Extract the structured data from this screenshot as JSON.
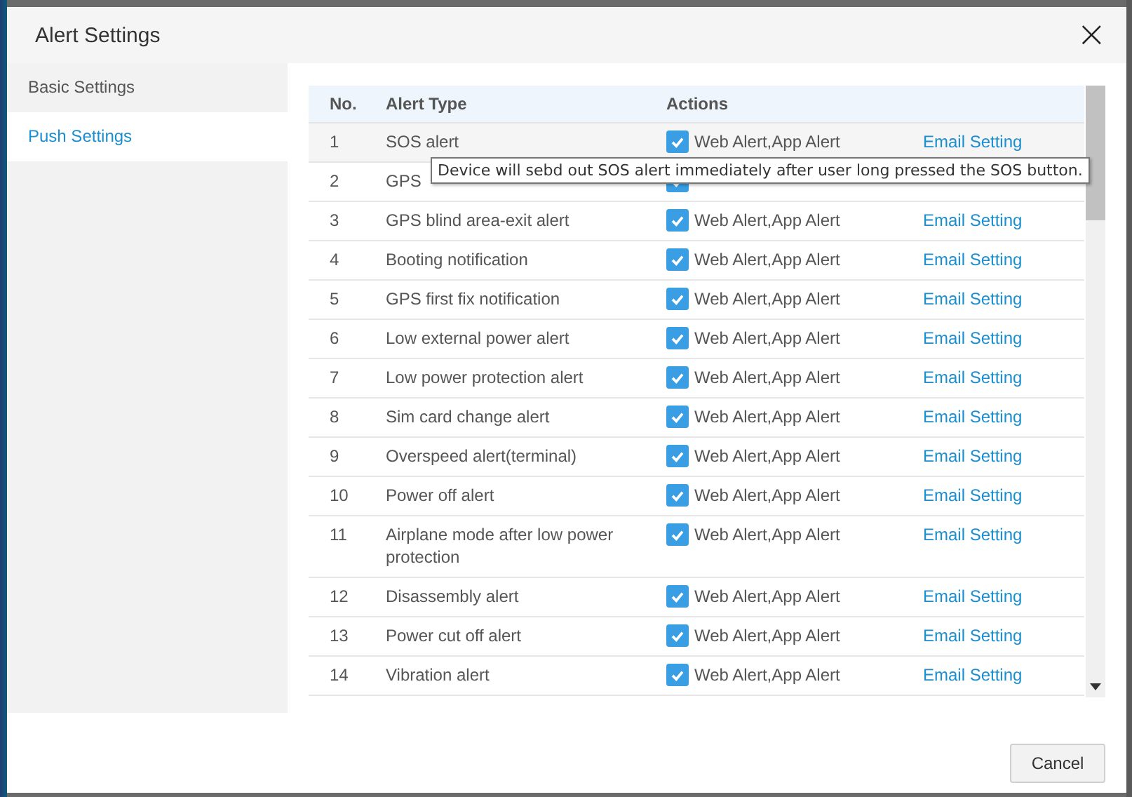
{
  "dialog": {
    "title": "Alert Settings",
    "close": "×"
  },
  "sidebar": {
    "items": [
      {
        "label": "Basic Settings",
        "selected": false
      },
      {
        "label": "Push Settings",
        "selected": true
      }
    ]
  },
  "table": {
    "columns": [
      "No.",
      "Alert Type",
      "Actions"
    ],
    "rows": [
      {
        "no": "1",
        "type": "SOS alert",
        "actions": "Web Alert,App Alert",
        "checked": true,
        "link": "Email Setting"
      },
      {
        "no": "2",
        "type": "GPS",
        "checked": true
      },
      {
        "no": "3",
        "type": "GPS blind area-exit alert",
        "actions": "Web Alert,App Alert",
        "checked": true,
        "link": "Email Setting"
      },
      {
        "no": "4",
        "type": "Booting notification",
        "actions": "Web Alert,App Alert",
        "checked": true,
        "link": "Email Setting"
      },
      {
        "no": "5",
        "type": "GPS first fix notification",
        "actions": "Web Alert,App Alert",
        "checked": true,
        "link": "Email Setting"
      },
      {
        "no": "6",
        "type": "Low external power alert",
        "actions": "Web Alert,App Alert",
        "checked": true,
        "link": "Email Setting"
      },
      {
        "no": "7",
        "type": "Low power protection alert",
        "actions": "Web Alert,App Alert",
        "checked": true,
        "link": "Email Setting"
      },
      {
        "no": "8",
        "type": "Sim card change alert",
        "actions": "Web Alert,App Alert",
        "checked": true,
        "link": "Email Setting"
      },
      {
        "no": "9",
        "type": "Overspeed alert(terminal)",
        "actions": "Web Alert,App Alert",
        "checked": true,
        "link": "Email Setting"
      },
      {
        "no": "10",
        "type": "Power off alert",
        "actions": "Web Alert,App Alert",
        "checked": true,
        "link": "Email Setting"
      },
      {
        "no": "11",
        "type": "Airplane mode after low power protection",
        "actions": "Web Alert,App Alert",
        "checked": true,
        "link": "Email Setting"
      },
      {
        "no": "12",
        "type": "Disassembly alert",
        "actions": "Web Alert,App Alert",
        "checked": true,
        "link": "Email Setting"
      },
      {
        "no": "13",
        "type": "Power cut off alert",
        "actions": "Web Alert,App Alert",
        "checked": true,
        "link": "Email Setting"
      },
      {
        "no": "14",
        "type": "Vibration alert",
        "actions": "Web Alert,App Alert",
        "checked": true,
        "link": "Email Setting"
      }
    ]
  },
  "tooltip": "Device will sebd out SOS alert immediately after user long pressed the SOS button.",
  "buttons": [
    "Cancel"
  ]
}
